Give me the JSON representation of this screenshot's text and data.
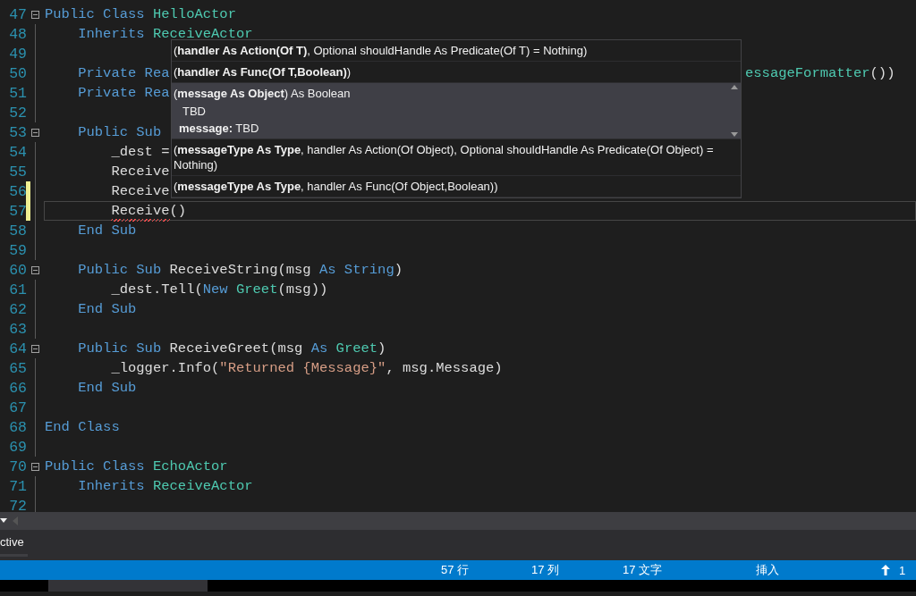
{
  "editor": {
    "lines": [
      {
        "number": "47",
        "fold": true,
        "tokens": [
          {
            "kind": "keyword",
            "text": "Public Class "
          },
          {
            "kind": "type",
            "text": "HelloActor"
          }
        ]
      },
      {
        "number": "48",
        "tokens": [
          {
            "kind": "keyword",
            "text": "    Inherits "
          },
          {
            "kind": "type",
            "text": "ReceiveActor"
          }
        ]
      },
      {
        "number": "49"
      },
      {
        "number": "50",
        "tokens": [
          {
            "kind": "keyword",
            "text": "    Private Rea"
          }
        ],
        "tail": [
          {
            "kind": "type",
            "text": "essageFormatter"
          },
          {
            "kind": "plain",
            "text": "())"
          }
        ]
      },
      {
        "number": "51",
        "tokens": [
          {
            "kind": "keyword",
            "text": "    Private Rea"
          }
        ]
      },
      {
        "number": "52"
      },
      {
        "number": "53",
        "fold": true,
        "tokens": [
          {
            "kind": "keyword",
            "text": "    Public Sub "
          }
        ]
      },
      {
        "number": "54",
        "tokens": [
          {
            "kind": "plain",
            "text": "        _dest ="
          }
        ]
      },
      {
        "number": "55",
        "tokens": [
          {
            "kind": "plain",
            "text": "        Receive"
          }
        ]
      },
      {
        "number": "56",
        "modified": true,
        "tokens": [
          {
            "kind": "plain",
            "text": "        Receive"
          }
        ]
      },
      {
        "number": "57",
        "modified": true,
        "current": true,
        "tokens": [
          {
            "kind": "plain",
            "text": "        Receive",
            "error": true
          },
          {
            "kind": "plain",
            "text": "()"
          }
        ]
      },
      {
        "number": "58",
        "tokens": [
          {
            "kind": "keyword",
            "text": "    End Sub"
          }
        ]
      },
      {
        "number": "59"
      },
      {
        "number": "60",
        "fold": true,
        "tokens": [
          {
            "kind": "keyword",
            "text": "    Public Sub "
          },
          {
            "kind": "plain",
            "text": "ReceiveString(msg "
          },
          {
            "kind": "keyword",
            "text": "As String"
          },
          {
            "kind": "plain",
            "text": ")"
          }
        ]
      },
      {
        "number": "61",
        "tokens": [
          {
            "kind": "plain",
            "text": "        _dest.Tell("
          },
          {
            "kind": "keyword",
            "text": "New "
          },
          {
            "kind": "type",
            "text": "Greet"
          },
          {
            "kind": "plain",
            "text": "(msg))"
          }
        ]
      },
      {
        "number": "62",
        "tokens": [
          {
            "kind": "keyword",
            "text": "    End Sub"
          }
        ]
      },
      {
        "number": "63"
      },
      {
        "number": "64",
        "fold": true,
        "tokens": [
          {
            "kind": "keyword",
            "text": "    Public Sub "
          },
          {
            "kind": "plain",
            "text": "ReceiveGreet(msg "
          },
          {
            "kind": "keyword",
            "text": "As "
          },
          {
            "kind": "type",
            "text": "Greet"
          },
          {
            "kind": "plain",
            "text": ")"
          }
        ]
      },
      {
        "number": "65",
        "tokens": [
          {
            "kind": "plain",
            "text": "        _logger.Info("
          },
          {
            "kind": "string",
            "text": "\"Returned {Message}\""
          },
          {
            "kind": "plain",
            "text": ", msg.Message)"
          }
        ]
      },
      {
        "number": "66",
        "tokens": [
          {
            "kind": "keyword",
            "text": "    End Sub"
          }
        ]
      },
      {
        "number": "67"
      },
      {
        "number": "68",
        "tokens": [
          {
            "kind": "keyword",
            "text": "End Class"
          }
        ]
      },
      {
        "number": "69"
      },
      {
        "number": "70",
        "fold": true,
        "tokens": [
          {
            "kind": "keyword",
            "text": "Public Class "
          },
          {
            "kind": "type",
            "text": "EchoActor"
          }
        ]
      },
      {
        "number": "71",
        "tokens": [
          {
            "kind": "keyword",
            "text": "    Inherits "
          },
          {
            "kind": "type",
            "text": "ReceiveActor"
          }
        ]
      },
      {
        "number": "72"
      }
    ]
  },
  "signature_popup": {
    "overloads": [
      {
        "signature": "(**handler As Action(Of T)**, Optional shouldHandle As Predicate(Of T)  = Nothing)",
        "selected": false
      },
      {
        "signature": "(**handler As Func(Of T,Boolean)**)",
        "selected": false
      },
      {
        "signature": "(**message As Object**) As Boolean",
        "selected": true,
        "description": "TBD",
        "parameter": "**message:** TBD"
      },
      {
        "signature": "(**messageType As Type**, handler As Action(Of Object), Optional shouldHandle As Predicate(Of Object)  = Nothing)",
        "selected": false
      },
      {
        "signature": "(**messageType As Type**, handler As Func(Of Object,Boolean))",
        "selected": false
      }
    ]
  },
  "panel": {
    "tab": "ctive"
  },
  "status_bar": {
    "line": "57 行",
    "column": "17 列",
    "char": "17 文字",
    "mode": "挿入",
    "pending": "1"
  }
}
